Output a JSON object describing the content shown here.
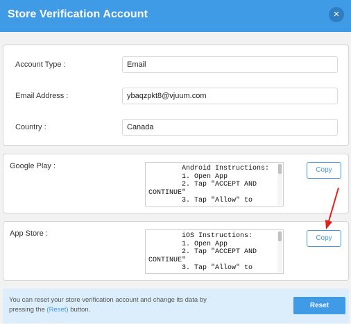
{
  "dialog": {
    "title": "Store Verification Account",
    "close_icon": "×"
  },
  "account": {
    "type_label": "Account Type :",
    "type_value": "Email",
    "email_label": "Email Address :",
    "email_value": "ybaqzpkt8@vjuum.com",
    "country_label": "Country :",
    "country_value": "Canada"
  },
  "google_play": {
    "label": "Google Play :",
    "instructions": "        Android Instructions:\n        1. Open App\n        2. Tap \"ACCEPT AND CONTINUE\"\n        3. Tap \"Allow\" to",
    "copy_label": "Copy"
  },
  "app_store": {
    "label": "App Store :",
    "instructions": "        iOS Instructions:\n        1. Open App\n        2. Tap \"ACCEPT AND CONTINUE\"\n        3. Tap \"Allow\" to",
    "copy_label": "Copy"
  },
  "footer": {
    "msg_part1": "You can reset your store verification account and change its data by pressing the ",
    "msg_link": "(Reset)",
    "msg_part2": " button.",
    "reset_label": "Reset"
  },
  "colors": {
    "accent": "#3f9be6",
    "annotation_arrow": "#e0201b"
  }
}
